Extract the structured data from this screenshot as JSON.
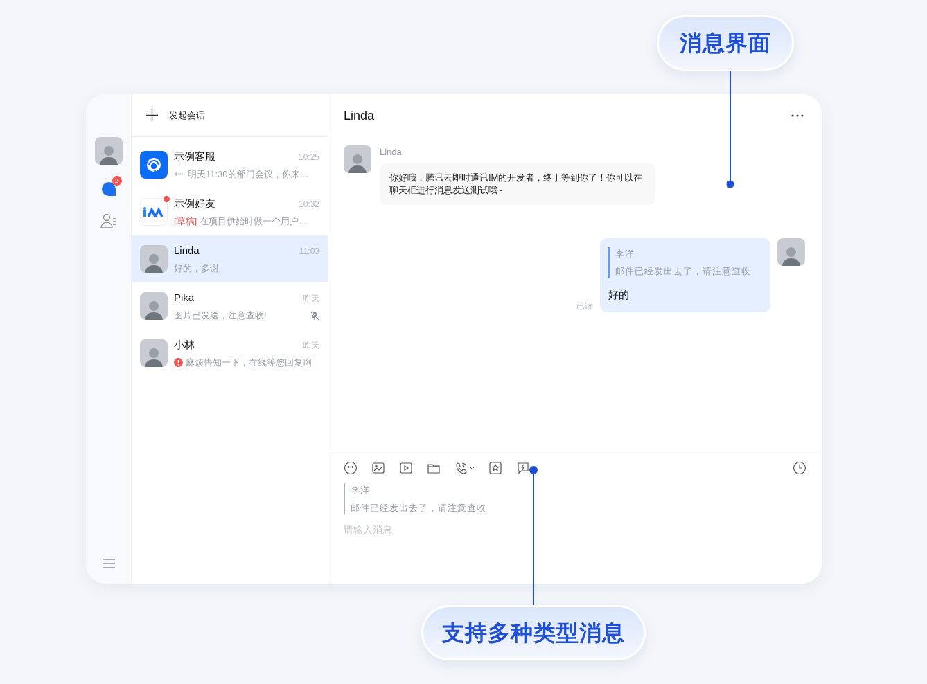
{
  "callouts": [
    {
      "label": "消息界面",
      "kind": "messages"
    },
    {
      "label": "支持多种类型消息",
      "kind": "toolbar"
    }
  ],
  "nav": {
    "items": [
      {
        "kind": "profile",
        "selected": false
      },
      {
        "kind": "chats",
        "selected": true,
        "badge": "2"
      },
      {
        "kind": "contacts",
        "selected": false
      }
    ]
  },
  "new_chat": {
    "label": "发起会话"
  },
  "conversations": [
    {
      "name": "示例客服",
      "time": "10:25",
      "preview": "明天11:30的部门会议，你来…",
      "kind": "service",
      "replied": true,
      "failed": false,
      "selected": false,
      "unread_dot": false,
      "muted": false
    },
    {
      "name": "示例好友",
      "time": "10:32",
      "preview": "在项目伊始时做一个用户…",
      "draft_label": "[草稿]",
      "kind": "logo",
      "replied": false,
      "failed": false,
      "selected": false,
      "unread_dot": true,
      "muted": false
    },
    {
      "name": "Linda",
      "time": "11:03",
      "preview": "好的，多谢",
      "kind": "photo",
      "replied": false,
      "failed": false,
      "selected": true,
      "unread_dot": false,
      "muted": false
    },
    {
      "name": "Pika",
      "time": "昨天",
      "preview": "图片已发送，注意查收!",
      "kind": "photo",
      "replied": false,
      "failed": false,
      "selected": false,
      "unread_dot": false,
      "muted": true
    },
    {
      "name": "小林",
      "time": "昨天",
      "preview": "麻烦告知一下，在线等您回复啊",
      "kind": "photo",
      "replied": false,
      "failed": true,
      "selected": false,
      "unread_dot": false,
      "muted": false
    }
  ],
  "chat": {
    "title": "Linda",
    "messages": [
      {
        "kind": "incoming",
        "sender": "Linda",
        "text": "你好哦，腾讯云即时通讯IM的开发者，终于等到你了！你可以在聊天框进行消息发送测试哦~"
      },
      {
        "kind": "outgoing",
        "quote": {
          "author": "李洋",
          "text": "邮件已经发出去了，请注意查收"
        },
        "text": "好的",
        "receipt": "已读"
      }
    ],
    "composer": {
      "tools": [
        {
          "kind": "emoji"
        },
        {
          "kind": "image"
        },
        {
          "kind": "video"
        },
        {
          "kind": "file"
        },
        {
          "kind": "call"
        },
        {
          "kind": "star"
        },
        {
          "kind": "quick"
        }
      ],
      "quote": {
        "author": "李洋",
        "text": "邮件已经发出去了，请注意查收"
      },
      "placeholder": "请输入消息"
    }
  }
}
